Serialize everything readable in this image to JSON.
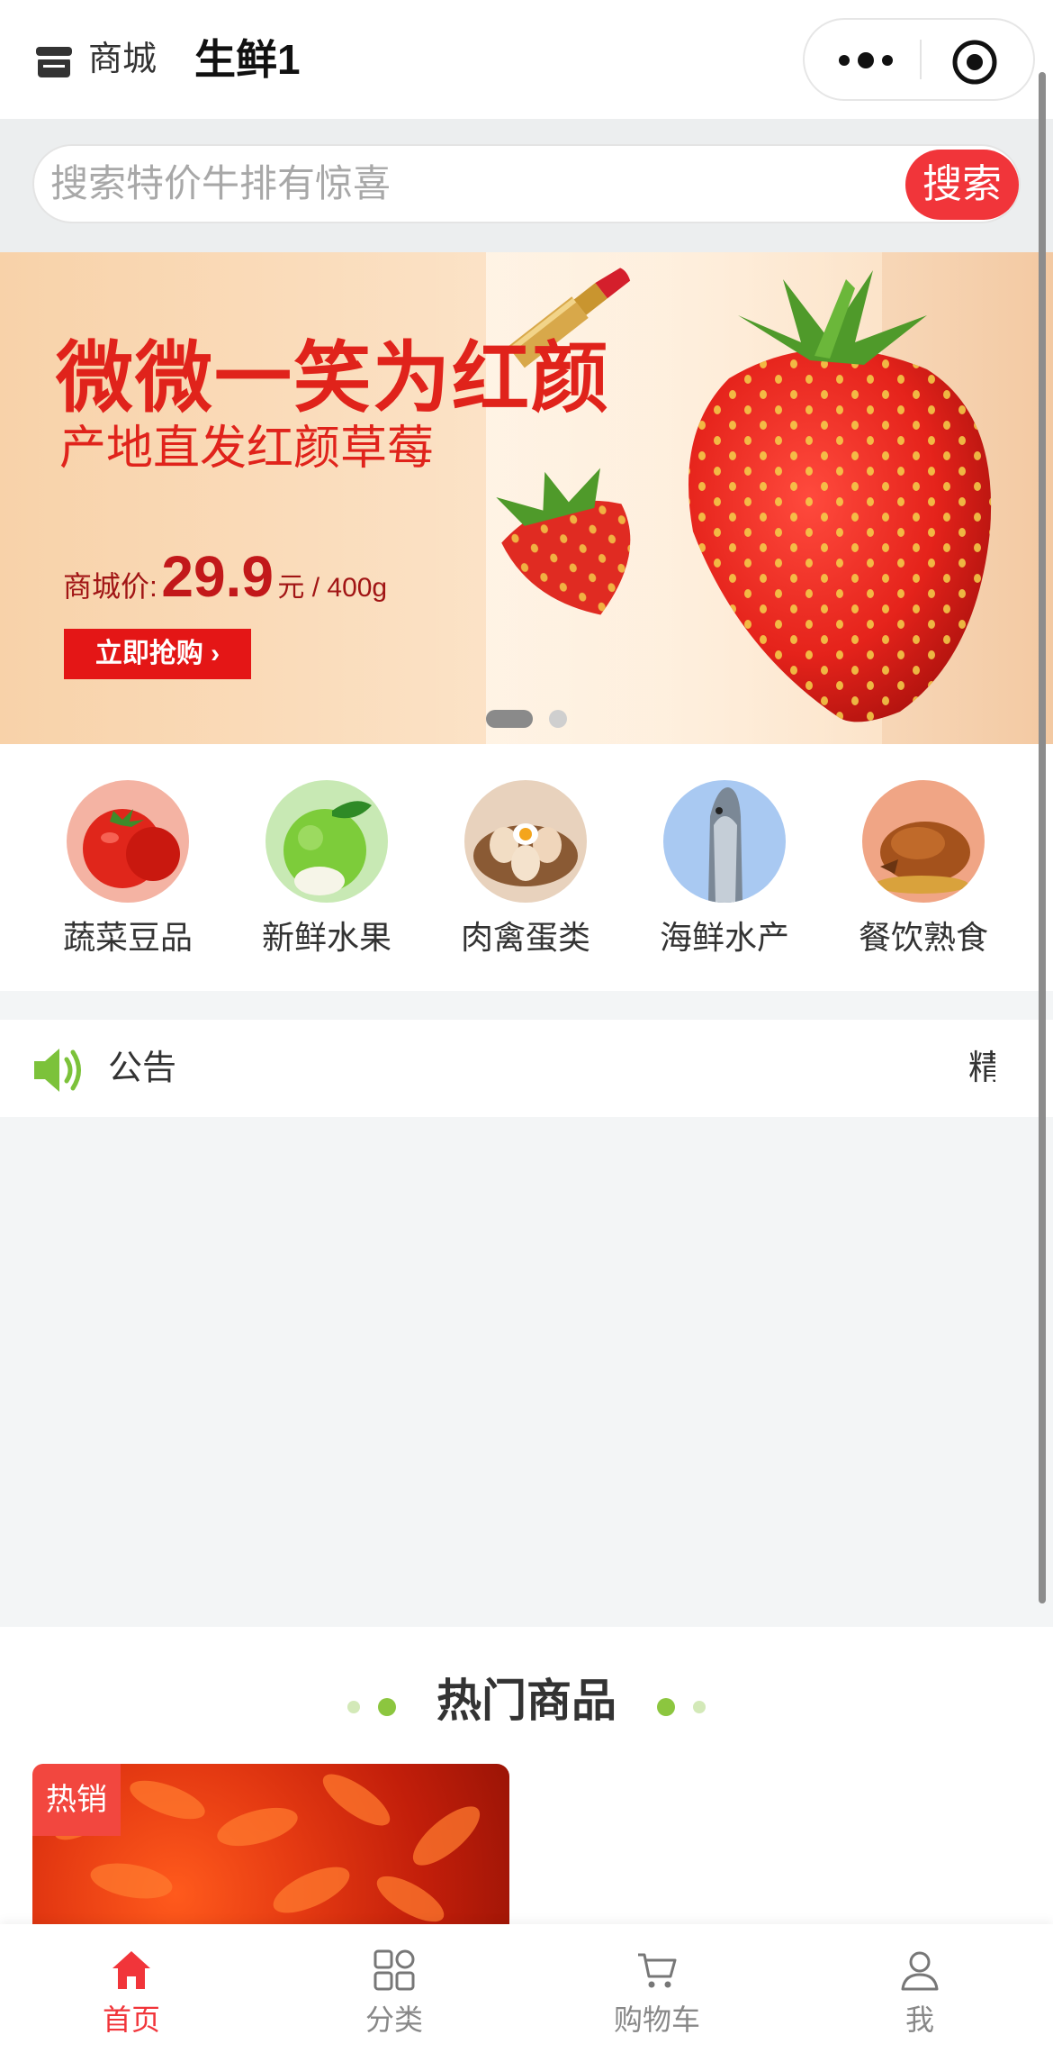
{
  "header": {
    "store_label": "商城",
    "title": "生鲜1",
    "more_icon": "more-dots-icon",
    "close_icon": "target-close-icon"
  },
  "search": {
    "placeholder": "搜索特价牛排有惊喜",
    "button_label": "搜索"
  },
  "banner": {
    "title": "微微一笑为红颜",
    "subtitle": "产地直发红颜草莓",
    "price_label": "商城价:",
    "price_value": "29.9",
    "price_unit": "元 / 400g",
    "cta_label": "立即抢购 ›",
    "slide_count": 2,
    "active_slide": 1
  },
  "categories": [
    {
      "label": "蔬菜豆品",
      "icon": "tomato-icon"
    },
    {
      "label": "新鲜水果",
      "icon": "apple-icon"
    },
    {
      "label": "肉禽蛋类",
      "icon": "eggs-icon"
    },
    {
      "label": "海鲜水产",
      "icon": "fish-icon"
    },
    {
      "label": "餐饮熟食",
      "icon": "roast-chicken-icon"
    }
  ],
  "notice": {
    "label": "公告",
    "text": "精"
  },
  "hot_section": {
    "title": "热门商品",
    "badge": "热销"
  },
  "tabbar": [
    {
      "label": "首页",
      "icon": "home-icon",
      "active": true
    },
    {
      "label": "分类",
      "icon": "category-grid-icon",
      "active": false
    },
    {
      "label": "购物车",
      "icon": "cart-icon",
      "active": false
    },
    {
      "label": "我",
      "icon": "user-icon",
      "active": false
    }
  ],
  "colors": {
    "accent": "#f1353a",
    "banner_red": "#e0231b",
    "green": "#8cc63f"
  }
}
